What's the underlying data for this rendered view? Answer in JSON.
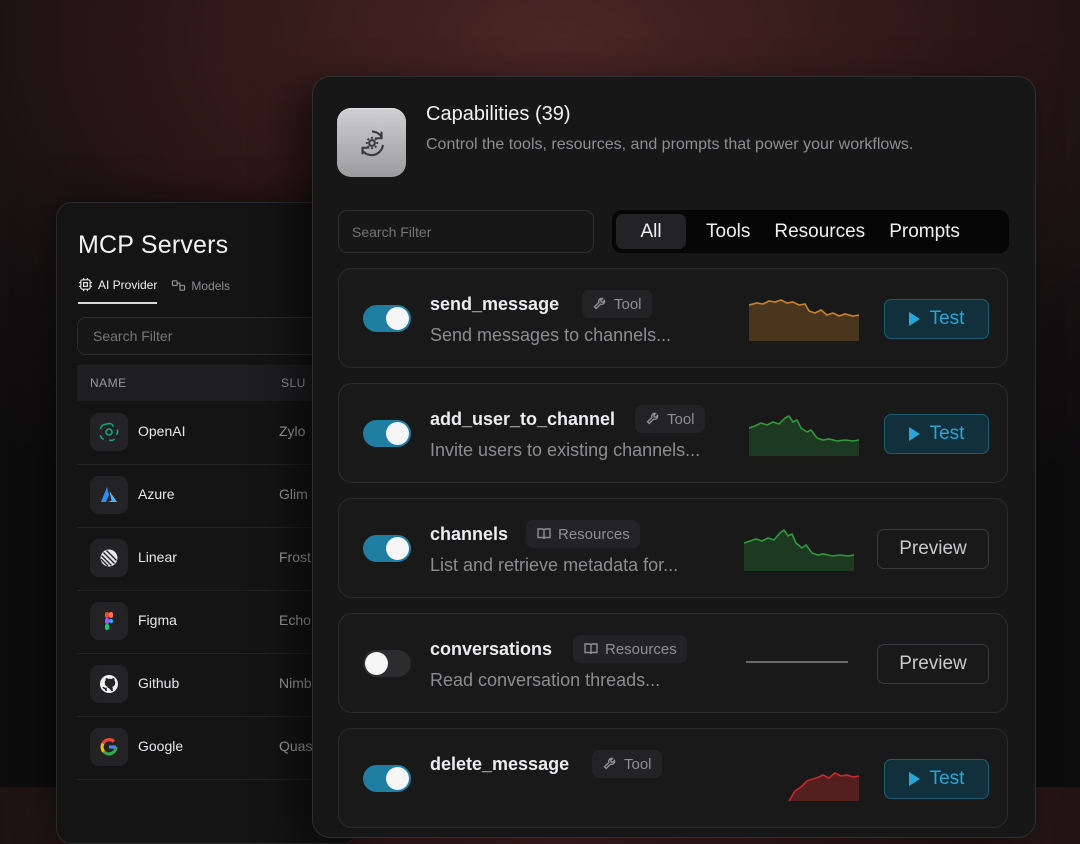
{
  "servers": {
    "title": "MCP Servers",
    "tabs": [
      {
        "label": "AI Provider",
        "icon": "chip-icon",
        "active": true
      },
      {
        "label": "Models",
        "icon": "models-icon",
        "active": false
      }
    ],
    "search_placeholder": "Search Filter",
    "columns": [
      "NAME",
      "SLU"
    ],
    "rows": [
      {
        "name": "OpenAI",
        "slug": "Zylo",
        "logo": "openai-logo"
      },
      {
        "name": "Azure",
        "slug": "Glim",
        "logo": "azure-logo"
      },
      {
        "name": "Linear",
        "slug": "Frost",
        "logo": "linear-logo"
      },
      {
        "name": "Figma",
        "slug": "Echo",
        "logo": "figma-logo"
      },
      {
        "name": "Github",
        "slug": "Nimb",
        "logo": "github-logo"
      },
      {
        "name": "Google",
        "slug": "Quas",
        "logo": "google-logo"
      }
    ]
  },
  "capabilities": {
    "title": "Capabilities (39)",
    "subtitle": "Control the tools, resources, and prompts that power your workflows.",
    "search_placeholder": "Search Filter",
    "filters": [
      {
        "label": "All",
        "active": true
      },
      {
        "label": "Tools",
        "active": false
      },
      {
        "label": "Resources",
        "active": false
      },
      {
        "label": "Prompts",
        "active": false
      }
    ],
    "items": [
      {
        "name": "send_message",
        "type": "Tool",
        "description": "Send messages to channels...",
        "enabled": true,
        "action": "Test",
        "spark_color": "#c9822a"
      },
      {
        "name": "add_user_to_channel",
        "type": "Tool",
        "description": "Invite users to existing channels...",
        "enabled": true,
        "action": "Test",
        "spark_color": "#2f9a3c"
      },
      {
        "name": "channels",
        "type": "Resources",
        "description": "List and retrieve metadata for...",
        "enabled": true,
        "action": "Preview",
        "spark_color": "#2f9a3c"
      },
      {
        "name": "conversations",
        "type": "Resources",
        "description": "Read conversation threads...",
        "enabled": false,
        "action": "Preview",
        "spark_color": "#6a6a6d"
      },
      {
        "name": "delete_message",
        "type": "Tool",
        "description": "",
        "enabled": true,
        "action": "Test",
        "spark_color": "#c42a2a"
      }
    ]
  },
  "colors": {
    "accent": "#27a7d8",
    "toggle_on": "#1f7ea1"
  }
}
